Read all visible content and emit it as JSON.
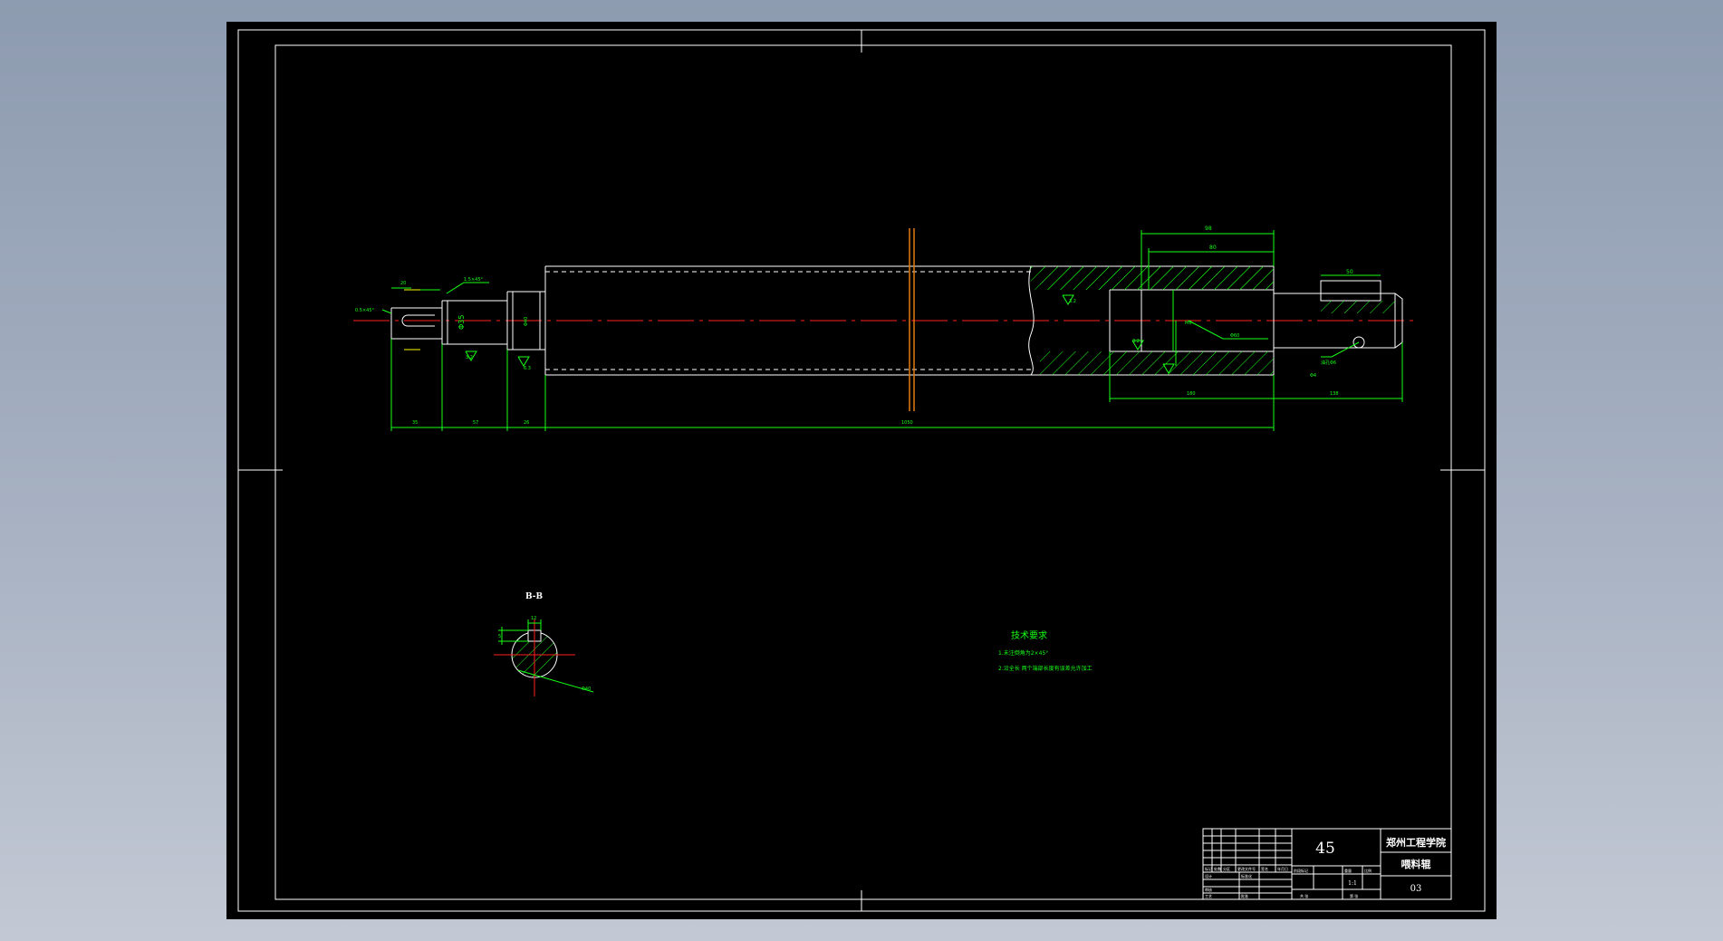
{
  "section_label": "B-B",
  "tech_requirements": {
    "title": "技术要求",
    "items": [
      "1.未注倒角为2×45°",
      "2.沿全长 两个端部长度有误差允许加工"
    ]
  },
  "dimensions": {
    "top_overall": "98",
    "top_inner": "80",
    "right_keyway": "50",
    "left_small_dia": "20",
    "chamfer_left": "0.5×45°",
    "chamfer_step": "1.5×45°",
    "dia_bearing": "Φ35",
    "dia_shoulder": "Φ40",
    "roughness_1": "3.2",
    "roughness_2": "3.2",
    "roughness_3": "3.2",
    "roughness_4": "6.3",
    "bottom_1": "35",
    "bottom_2": "57",
    "bottom_3": "26",
    "bottom_total": "1050",
    "bottom_right_1": "180",
    "bottom_right_2": "138",
    "note_thread": "M6",
    "note_hole_1": "油孔Φ6",
    "note_hole_2": "Φ4",
    "note_bore": "Φ60",
    "section_dia": "Φ40",
    "section_key_w": "12",
    "section_key_h": "5"
  },
  "title_block": {
    "material": "45",
    "school": "郑州工程学院",
    "part_name": "喂料辊",
    "drawing_no": "03",
    "scale": "1:1",
    "row_labels": [
      "标记",
      "处数",
      "分区",
      "更改文件号",
      "签名",
      "年月日"
    ],
    "sub_labels": [
      "设计",
      "标准化",
      "审核",
      "工艺",
      "批准"
    ],
    "stage_labels": [
      "阶段标记",
      "重量",
      "比例"
    ],
    "sheet_labels": [
      "共 张",
      "第 张"
    ]
  },
  "colors": {
    "background": "#000000",
    "frame": "#ffffff",
    "dimension": "#16ff16",
    "centerline": "#ff2020",
    "cutline": "#e07a10",
    "hatch": "#16ff16",
    "roughness": "#ffff00"
  }
}
